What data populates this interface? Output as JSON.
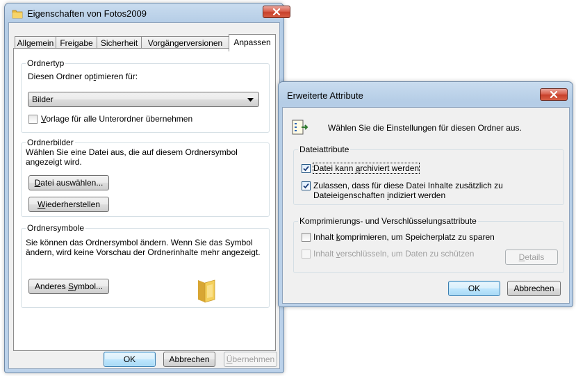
{
  "main_dialog": {
    "title": "Eigenschaften von Fotos2009",
    "tabs": [
      {
        "label": "Allgemein"
      },
      {
        "label": "Freigabe"
      },
      {
        "label": "Sicherheit"
      },
      {
        "label": "Vorgängerversionen"
      },
      {
        "label": "Anpassen"
      }
    ],
    "active_tab": "Anpassen",
    "folder_type": {
      "group_title": "Ordnertyp",
      "optimize_label_pre": "Diesen Ordner op",
      "optimize_label_key": "t",
      "optimize_label_post": "imieren für:",
      "selected_value": "Bilder",
      "template_pre": "",
      "template_key": "V",
      "template_post": "orlage für alle Unterordner übernehmen",
      "template_checked": false
    },
    "folder_pictures": {
      "group_title": "Ordnerbilder",
      "description_line1": "Wählen Sie eine Datei aus, die auf diesem Ordnersymbol",
      "description_line2": "angezeigt wird.",
      "choose_pre": "",
      "choose_key": "D",
      "choose_post": "atei auswählen...",
      "restore_pre": "",
      "restore_key": "W",
      "restore_post": "iederherstellen"
    },
    "folder_icons": {
      "group_title": "Ordnersymbole",
      "description_line1": "Sie können das Ordnersymbol ändern. Wenn Sie das Symbol",
      "description_line2": "ändern, wird keine Vorschau der Ordnerinhalte mehr angezeigt.",
      "change_pre": "Anderes ",
      "change_key": "S",
      "change_post": "ymbol..."
    },
    "buttons": {
      "ok": "OK",
      "cancel": "Abbrechen",
      "apply_key": "Ü",
      "apply_post": "bernehmen"
    }
  },
  "attr_dialog": {
    "title": "Erweiterte Attribute",
    "intro": "Wählen Sie die Einstellungen für diesen Ordner aus.",
    "file_attributes": {
      "group_title": "Dateiattribute",
      "archive_pre": "Datei kann ",
      "archive_key": "a",
      "archive_post": "rchiviert werden",
      "archive_checked": true,
      "index_line1": "Zulassen, dass für diese Datei Inhalte zusätzlich zu",
      "index_line2_pre": "Dateieigenschaften ",
      "index_line2_key": "i",
      "index_line2_post": "ndiziert werden",
      "index_checked": true
    },
    "compress_encrypt": {
      "group_title": "Komprimierungs- und Verschlüsselungsattribute",
      "compress_pre": "Inhalt ",
      "compress_key": "k",
      "compress_post": "omprimieren, um Speicherplatz zu sparen",
      "compress_checked": false,
      "encrypt_pre": "Inhalt ",
      "encrypt_key": "v",
      "encrypt_post": "erschlüsseln, um Daten zu schützen",
      "encrypt_checked": false,
      "details_key": "D",
      "details_post": "etails"
    },
    "buttons": {
      "ok": "OK",
      "cancel": "Abbrechen"
    }
  },
  "colors": {
    "title_bar": "#bcd2ea",
    "client_bg": "#f0f0f0",
    "close_red": "#c7402b",
    "default_button_border": "#3c7fb1",
    "folder_yellow": "#f2c94c"
  },
  "icons": [
    "folder-icon",
    "close-icon",
    "dropdown-arrow-icon",
    "checkmark-icon",
    "attributes-icon",
    "large-folder-icon"
  ]
}
